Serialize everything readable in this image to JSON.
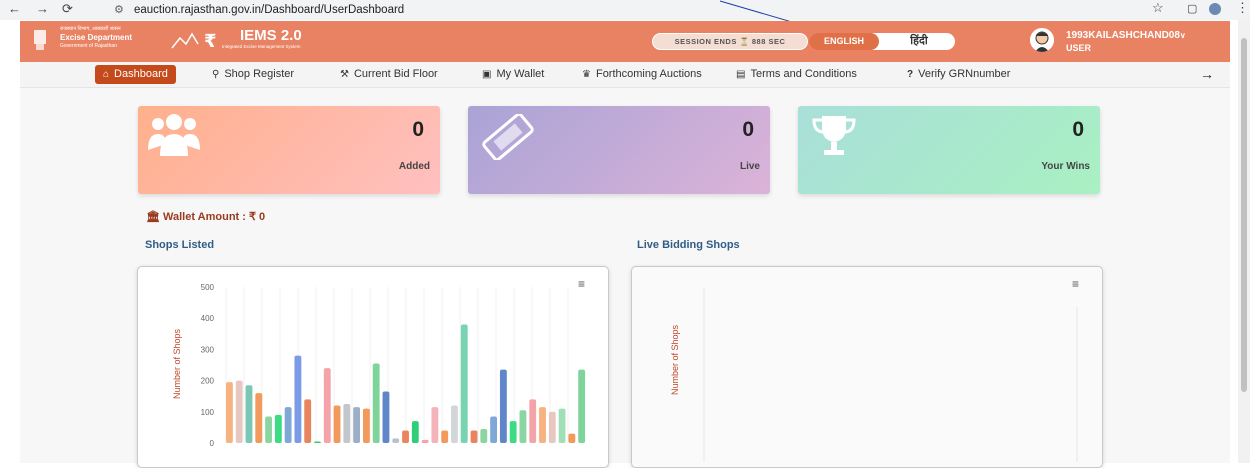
{
  "browser": {
    "url": "eauction.rajasthan.gov.in/Dashboard/UserDashboard",
    "icons": [
      "back-arrow-icon",
      "forward-arrow-icon",
      "reload-icon",
      "site-settings-icon",
      "bookmark-star-icon",
      "tab-icon",
      "profile-icon",
      "menu-dots-icon"
    ]
  },
  "header": {
    "dept_small": "राजस्थान विभाग, आबकारी शासन",
    "dept_name": "Excise Department",
    "dept_sub": "Government of Rajasthan",
    "app_title": "IEMS 2.0",
    "app_subtitle": "Integrated Excise Management System",
    "session_text": "SESSION ENDS",
    "session_value": "888 SEC",
    "lang_english": "ENGLISH",
    "lang_hindi": "हिंदी",
    "user_name": "1993KAILASHCHAND08",
    "user_role": "USER"
  },
  "menu": {
    "items": [
      {
        "label": "Dashboard",
        "icon": "home-icon"
      },
      {
        "label": "Shop Register",
        "icon": "bicycle-icon"
      },
      {
        "label": "Current Bid Floor",
        "icon": "gavel-icon"
      },
      {
        "label": "My Wallet",
        "icon": "wallet-icon"
      },
      {
        "label": "Forthcoming Auctions",
        "icon": "trophy-icon"
      },
      {
        "label": "Terms and Conditions",
        "icon": "file-icon"
      },
      {
        "label": "Verify GRNnumber",
        "icon": "question-icon"
      }
    ]
  },
  "stats": [
    {
      "value": "0",
      "label": "Added",
      "icon": "users-icon"
    },
    {
      "value": "0",
      "label": "Live",
      "icon": "ticket-icon"
    },
    {
      "value": "0",
      "label": "Your Wins",
      "icon": "trophy-icon"
    }
  ],
  "wallet": {
    "label": "Wallet Amount :",
    "value": "₹ 0"
  },
  "sections": {
    "shops_listed": "Shops Listed",
    "live_bidding": "Live Bidding Shops"
  },
  "chart_data": [
    {
      "type": "bar",
      "title": "Shops Listed",
      "ylabel": "Number of Shops",
      "ylim": [
        0,
        500
      ],
      "yticks": [
        0,
        100,
        200,
        300,
        400,
        500
      ],
      "values": [
        195,
        200,
        185,
        160,
        85,
        90,
        115,
        280,
        140,
        5,
        240,
        120,
        125,
        115,
        110,
        255,
        165,
        15,
        40,
        70,
        10,
        115,
        40,
        120,
        380,
        40,
        45,
        85,
        235,
        70,
        105,
        140,
        115,
        100,
        110,
        30,
        235
      ],
      "colors": [
        "#f7b27f",
        "#e8c7c0",
        "#79c7b4",
        "#f29a5c",
        "#8bd6a0",
        "#3ddc84",
        "#7fa8d6",
        "#7b9be6",
        "#e8855e",
        "#47c26f",
        "#f4a3a8",
        "#f29a5c",
        "#c2c7cc",
        "#9bb0c6",
        "#f29a5c",
        "#7fd49a",
        "#5f86c8",
        "#b8c2cf",
        "#e8855e",
        "#2fcf7a",
        "#f4a3a8",
        "#f4b3b8",
        "#f29a5c",
        "#d3d6d9",
        "#78d4b0",
        "#e8855e",
        "#8bd6a0",
        "#7fa8d6",
        "#5f86c8",
        "#3ddc84",
        "#8bd6a0",
        "#f4a3a8",
        "#f7b27f",
        "#e8c7c0",
        "#9fe0b8",
        "#f29a5c",
        "#7fd49a"
      ]
    },
    {
      "type": "bar",
      "title": "Live Bidding Shops",
      "ylabel": "Number of Shops",
      "values": []
    }
  ]
}
